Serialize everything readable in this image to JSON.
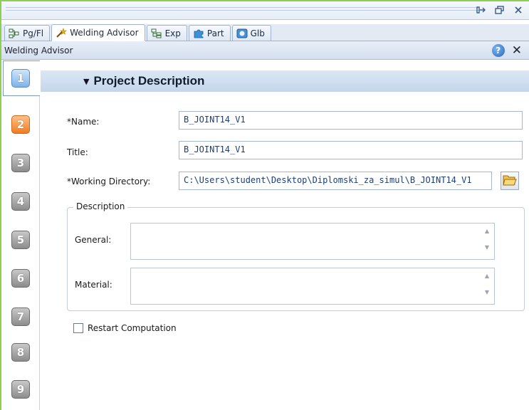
{
  "window": {
    "controls": [
      "pin-icon",
      "restore-icon",
      "close-icon"
    ]
  },
  "tabs": [
    {
      "label": "Pg/Fl",
      "icon": "page-flow-icon",
      "active": false
    },
    {
      "label": "Welding Advisor",
      "icon": "wand-icon",
      "active": true
    },
    {
      "label": "Exp",
      "icon": "explorer-icon",
      "active": false
    },
    {
      "label": "Part",
      "icon": "puzzle-icon",
      "active": false
    },
    {
      "label": "Glb",
      "icon": "globe-icon",
      "active": false
    }
  ],
  "panel": {
    "title": "Welding Advisor",
    "help_symbol": "?",
    "close_symbol": "✕"
  },
  "steps": [
    {
      "number": "1",
      "state": "active"
    },
    {
      "number": "2",
      "state": "warning"
    },
    {
      "number": "3",
      "state": "normal"
    },
    {
      "number": "4",
      "state": "normal"
    },
    {
      "number": "5",
      "state": "normal"
    },
    {
      "number": "6",
      "state": "normal"
    },
    {
      "number": "7",
      "state": "normal"
    },
    {
      "number": "8",
      "state": "normal"
    },
    {
      "number": "9",
      "state": "normal"
    }
  ],
  "section": {
    "title": "Project Description",
    "caret": "▼"
  },
  "form": {
    "name_label": "*Name:",
    "name_value": "B_JOINT14_V1",
    "title_label": "Title:",
    "title_value": "B_JOINT14_V1",
    "workdir_label": "*Working Directory:",
    "workdir_value": "C:\\Users\\student\\Desktop\\Diplomski_za_simul\\B_JOINT14_V1",
    "browse_icon": "folder-open-icon"
  },
  "description": {
    "legend": "Description",
    "general_label": "General:",
    "general_value": "",
    "material_label": "Material:",
    "material_value": ""
  },
  "restart": {
    "label": "Restart Computation",
    "checked": false
  },
  "colors": {
    "frame_accent": "#8fcf50",
    "header_blue": "#c4d6ec",
    "field_text": "#1a3f7a",
    "step_active": "#7fb3e8",
    "step_warning": "#f07c22"
  }
}
